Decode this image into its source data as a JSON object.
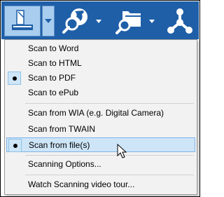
{
  "colors": {
    "toolbar_bg": "#1f5fa8",
    "active_button_bg": "#a9cdef",
    "menu_bg": "#f2f2f2",
    "hover_bg": "#cde5f7"
  },
  "toolbar": {
    "buttons": [
      {
        "name": "scan",
        "icon": "scanner-icon",
        "active": true
      },
      {
        "name": "scan-dropdown",
        "icon": "chevron-down-icon"
      },
      {
        "name": "web-search",
        "icon": "globe-search-icon"
      },
      {
        "name": "web-search-dropdown",
        "icon": "chevron-down-icon"
      },
      {
        "name": "folder-search",
        "icon": "folder-search-icon"
      },
      {
        "name": "folder-search-dropdown",
        "icon": "chevron-down-icon"
      },
      {
        "name": "share",
        "icon": "share-network-icon"
      }
    ]
  },
  "menu": {
    "items": [
      {
        "label": "Scan to Word",
        "checked": false
      },
      {
        "label": "Scan to HTML",
        "checked": false
      },
      {
        "label": "Scan to PDF",
        "checked": true
      },
      {
        "label": "Scan to ePub",
        "checked": false
      },
      {
        "label": "Scan from WIA (e.g. Digital Camera)",
        "checked": false
      },
      {
        "label": "Scan from TWAIN",
        "checked": false
      },
      {
        "label": "Scan from file(s)",
        "checked": true,
        "hover": true
      },
      {
        "label": "Scanning Options...",
        "checked": false
      },
      {
        "label": "Watch Scanning video tour...",
        "checked": false
      }
    ]
  }
}
